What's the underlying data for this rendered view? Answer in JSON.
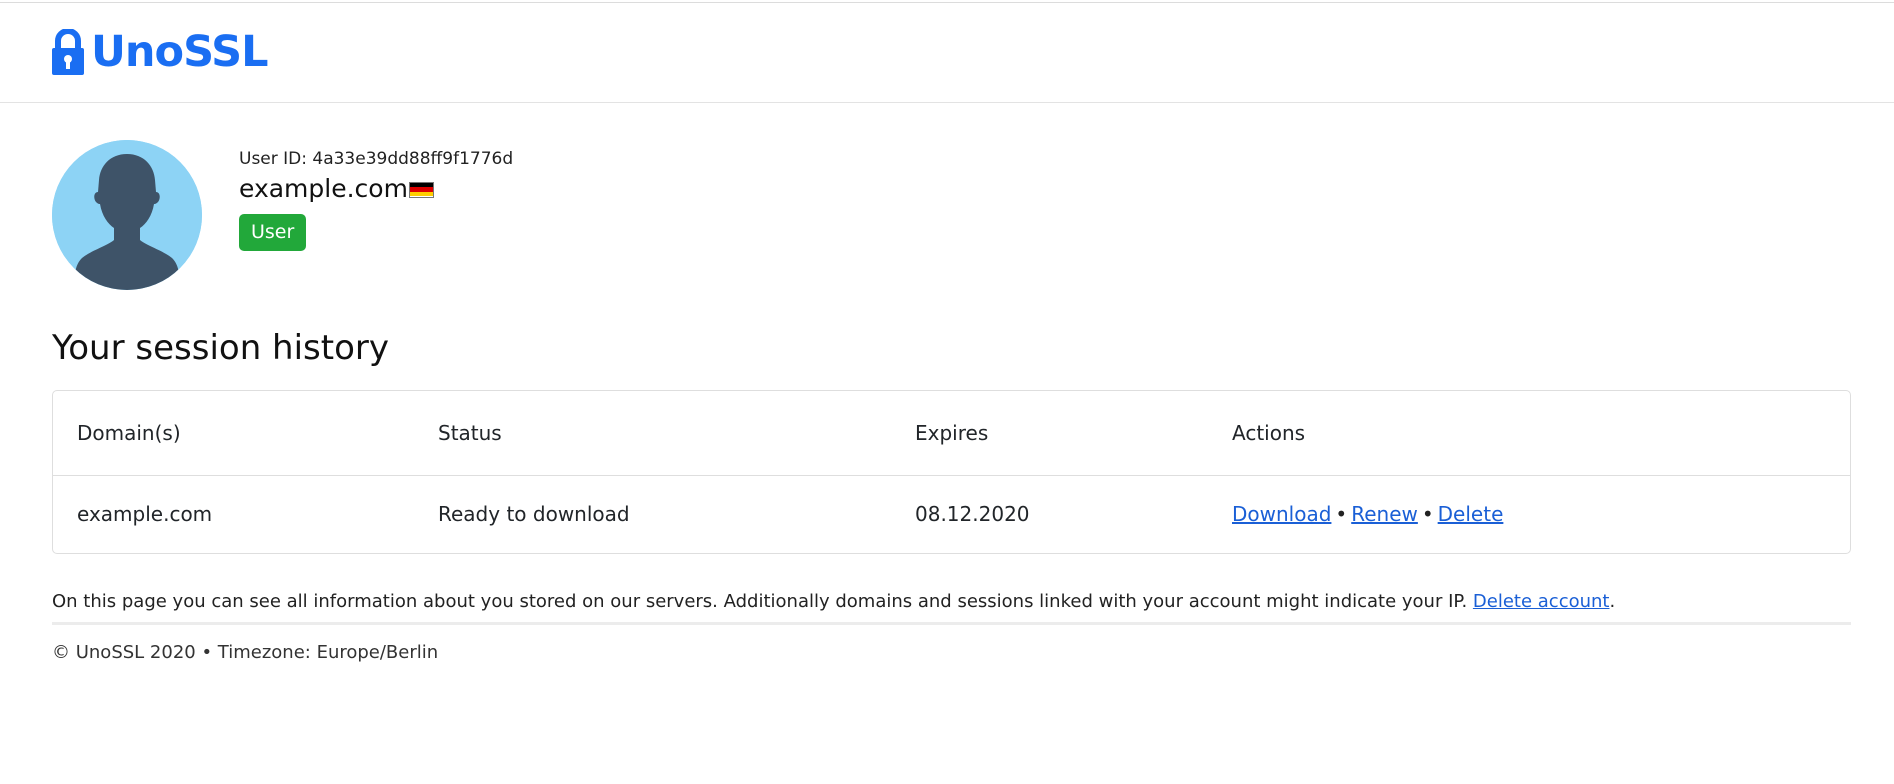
{
  "brand": {
    "name": "UnoSSL",
    "color": "#1a6ef2"
  },
  "profile": {
    "user_id_text": "User ID: 4a33e39dd88ff9f1776d",
    "domain": "example.com",
    "flag_icon": "germany-flag-icon",
    "role_badge": "User",
    "badge_color": "#22a83a",
    "avatar_icon": "user-silhouette-icon"
  },
  "session_history": {
    "title": "Your session history",
    "columns": [
      "Domain(s)",
      "Status",
      "Expires",
      "Actions"
    ],
    "rows": [
      {
        "domain": "example.com",
        "status": "Ready to download",
        "expires": "08.12.2020",
        "actions": [
          "Download",
          "Renew",
          "Delete"
        ]
      }
    ],
    "separator": "•"
  },
  "note": {
    "text": "On this page you can see all information about you stored on our servers. Additionally domains and sessions linked with your account might indicate your IP.",
    "link": "Delete account",
    "suffix": "."
  },
  "footer": {
    "text": "© UnoSSL 2020 • Timezone: Europe/Berlin"
  },
  "colors": {
    "link": "#1a5fd6",
    "avatar_bg": "#8dd3f5",
    "avatar_fg": "#3e5368"
  }
}
